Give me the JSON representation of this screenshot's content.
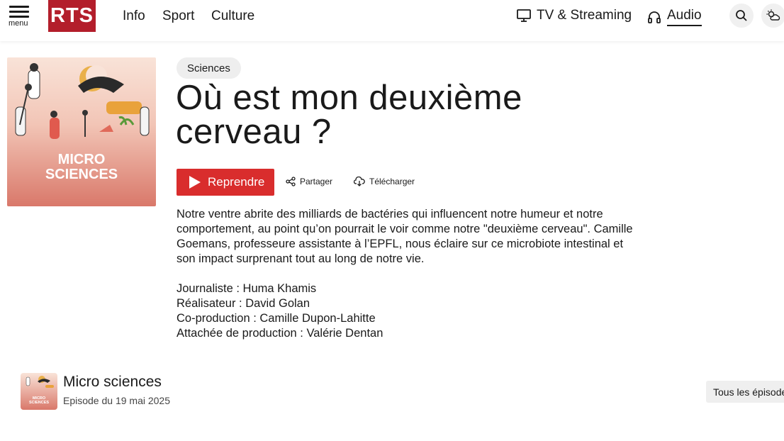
{
  "header": {
    "menu_label": "menu",
    "logo_text": "RTS",
    "nav_items": [
      "Info",
      "Sport",
      "Culture"
    ],
    "tv_label": "TV & Streaming",
    "audio_label": "Audio"
  },
  "episode": {
    "category": "Sciences",
    "title": "Où est mon deuxième cerveau ?",
    "cover_text": [
      "MICRO",
      "SCIENCES"
    ],
    "play_label": "Reprendre",
    "share_label": "Partager",
    "download_label": "Télécharger",
    "description": "Notre ventre abrite des milliards de bactéries qui influencent notre humeur et notre comportement, au point qu’on pourrait le voir comme notre \"deuxième cerveau\". Camille Goemans, professeure assistante à l’EPFL, nous éclaire sur ce microbiote intestinal et son impact surprenant tout au long de notre vie.",
    "credits": [
      "Journaliste : Huma Khamis",
      "Réalisateur : David Golan",
      "Co-production : Camille Dupon-Lahitte",
      "Attachée de production : Valérie Dentan"
    ]
  },
  "show": {
    "name": "Micro sciences",
    "date": "Episode du 19 mai 2025",
    "all_episodes_label": "Tous les épisodes"
  },
  "colors": {
    "brand_red": "#b31e2b",
    "play_red": "#d92d2d",
    "cover_top": "#f7ddd0",
    "cover_bottom": "#d9786a"
  }
}
